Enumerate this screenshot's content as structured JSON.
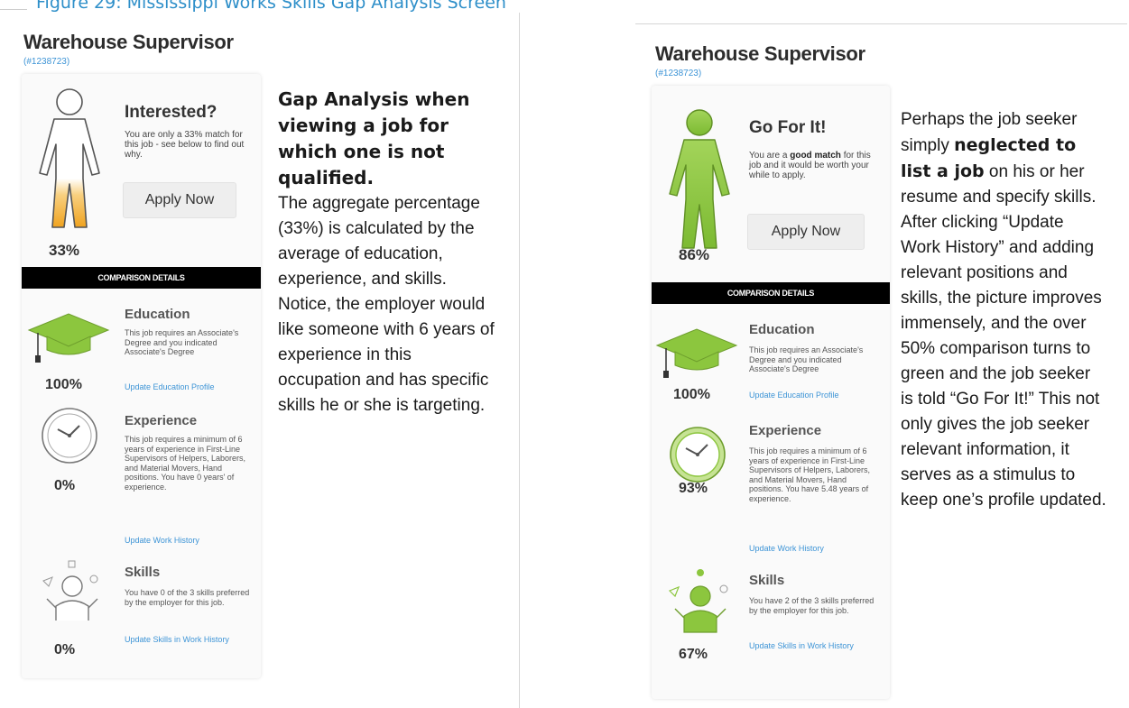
{
  "figure_caption": "Figure 29: Mississippi Works Skills Gap Analysis Screen",
  "colors": {
    "orange": "#f0a31f",
    "green": "#8cc63e",
    "link": "#3d94d6",
    "caption": "#2e8fc9"
  },
  "left": {
    "job_title": "Warehouse Supervisor",
    "job_id": "(#1238723)",
    "status_title": "Interested?",
    "status_text": "You are only a 33% match for this job - see below to find out why.",
    "apply_label": "Apply Now",
    "overall_pct": "33%",
    "comparison_label": "COMPARISON DETAILS",
    "education": {
      "title": "Education",
      "text": "This job requires an Associate's Degree and you indicated Associate's Degree",
      "link": "Update Education Profile",
      "pct": "100%"
    },
    "experience": {
      "title": "Experience",
      "text": "This job requires a minimum of 6 years of experience in First-Line Supervisors of Helpers, Laborers, and Material Movers, Hand positions. You have 0 years' of experience.",
      "link": "Update Work History",
      "pct": "0%"
    },
    "skills": {
      "title": "Skills",
      "text": "You have 0 of the 3 skills preferred by the employer for this job.",
      "link": "Update Skills in Work History",
      "pct": "0%"
    },
    "description": {
      "heading": "Gap Analysis when viewing a job for which one is not qualified.",
      "body": "The aggregate percentage (33%) is calculated by the average of education, experience, and skills. Notice, the employer would like someone with 6 years of experience in this occupation and has specific skills he or she is targeting."
    }
  },
  "right": {
    "job_title": "Warehouse Supervisor",
    "job_id": "(#1238723)",
    "status_title": "Go For It!",
    "status_text_pre": "You are a",
    "status_text_strong": "good match",
    "status_text_post": "for this job and it would be worth your while to apply.",
    "apply_label": "Apply Now",
    "overall_pct": "86%",
    "comparison_label": "COMPARISON DETAILS",
    "education": {
      "title": "Education",
      "text": "This job requires an Associate's Degree and you indicated Associate's Degree",
      "link": "Update Education Profile",
      "pct": "100%"
    },
    "experience": {
      "title": "Experience",
      "text": "This job requires a minimum of 6 years of experience in First-Line Supervisors of Helpers, Laborers, and Material Movers, Hand positions. You have 5.48 years of experience.",
      "link": "Update Work History",
      "pct": "93%"
    },
    "skills": {
      "title": "Skills",
      "text": "You have 2 of the 3 skills preferred by the employer for this job.",
      "link": "Update Skills in Work History",
      "pct": "67%"
    },
    "description": {
      "pre": "Perhaps the job seeker simply",
      "strong": "neglected to list a job",
      "post": "on his or her resume and specify skills. After clicking “Update Work History” and adding relevant positions and skills, the picture improves immensely, and the over 50% comparison turns to green and the job seeker is told “Go For It!” This not only gives the job seeker relevant information, it serves as a stimulus to keep one’s profile updated."
    }
  }
}
